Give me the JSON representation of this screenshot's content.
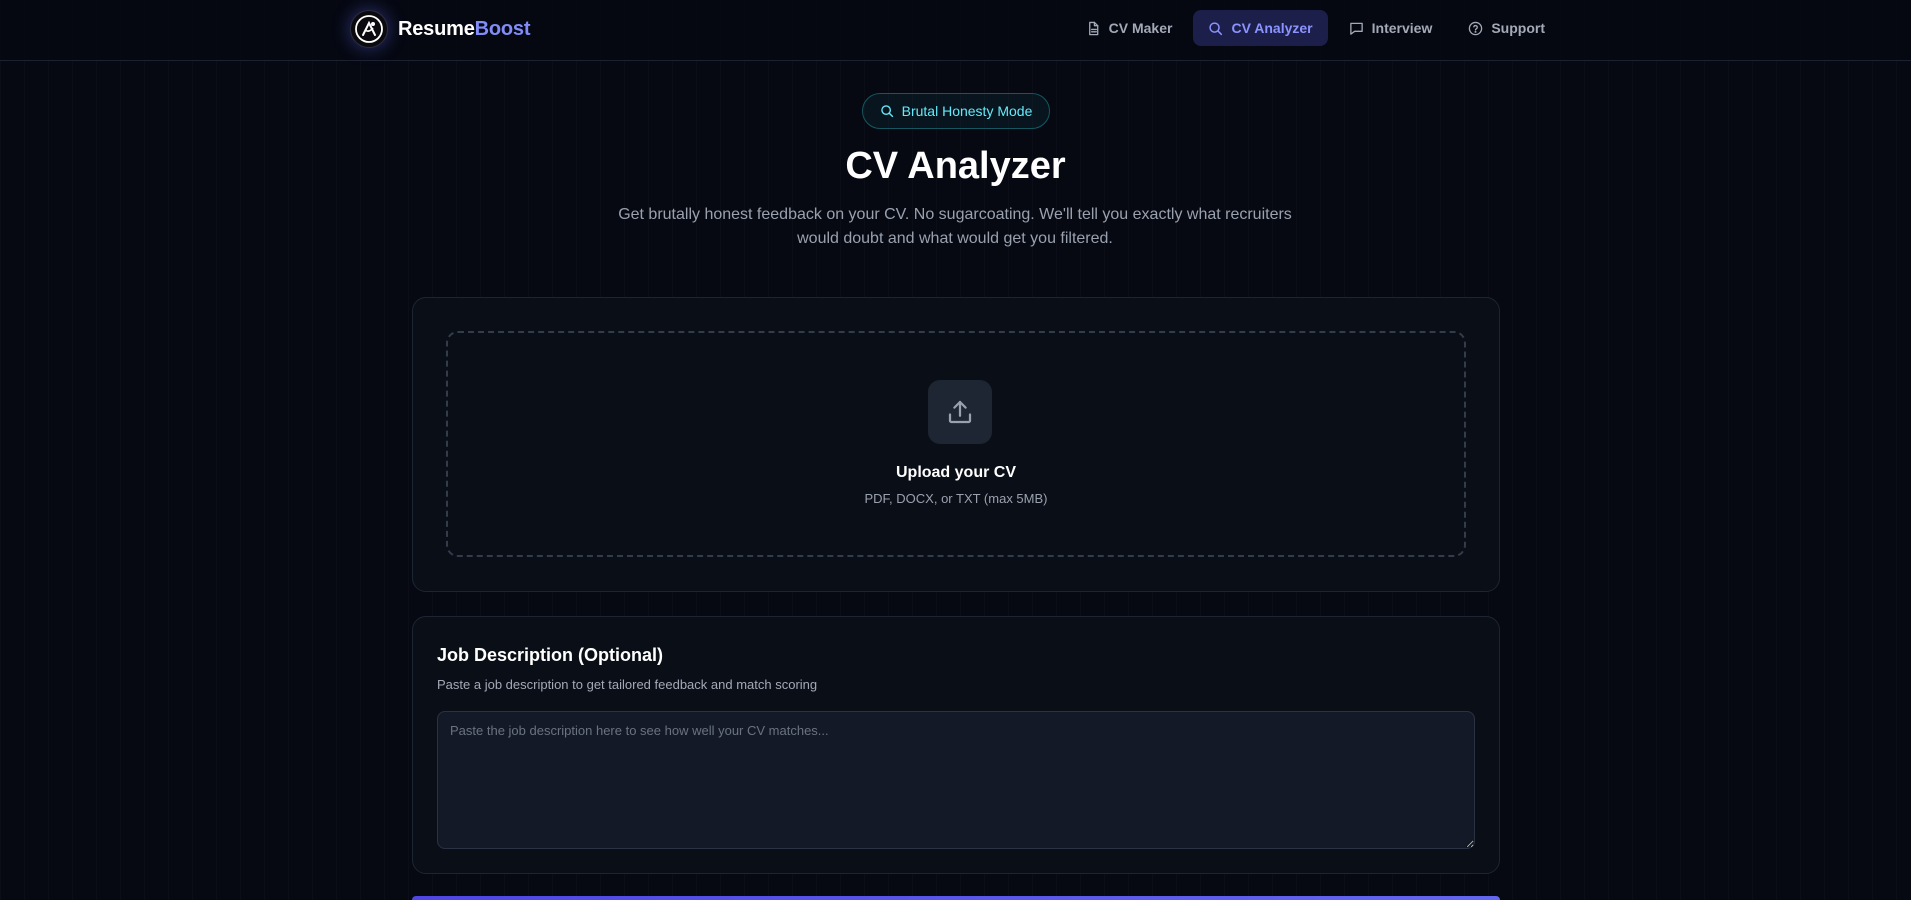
{
  "brand": {
    "name_main": "Resume",
    "name_accent": "Boost"
  },
  "nav": {
    "items": [
      {
        "label": "CV Maker",
        "icon": "document-icon",
        "active": false
      },
      {
        "label": "CV Analyzer",
        "icon": "search-icon",
        "active": true
      },
      {
        "label": "Interview",
        "icon": "chat-icon",
        "active": false
      },
      {
        "label": "Support",
        "icon": "help-circle-icon",
        "active": false
      }
    ]
  },
  "hero": {
    "badge": "Brutal Honesty Mode",
    "title": "CV Analyzer",
    "subtitle": "Get brutally honest feedback on your CV. No sugarcoating. We'll tell you exactly what recruiters would doubt and what would get you filtered."
  },
  "upload": {
    "title": "Upload your CV",
    "hint": "PDF, DOCX, or TXT (max 5MB)"
  },
  "job_description": {
    "title": "Job Description (Optional)",
    "subtitle": "Paste a job description to get tailored feedback and match scoring",
    "placeholder": "Paste the job description here to see how well your CV matches...",
    "value": ""
  },
  "colors": {
    "background": "#060912",
    "accent": "#818cf8",
    "active_nav_bg": "#1c1f4a",
    "badge_text": "#67e8f9"
  }
}
